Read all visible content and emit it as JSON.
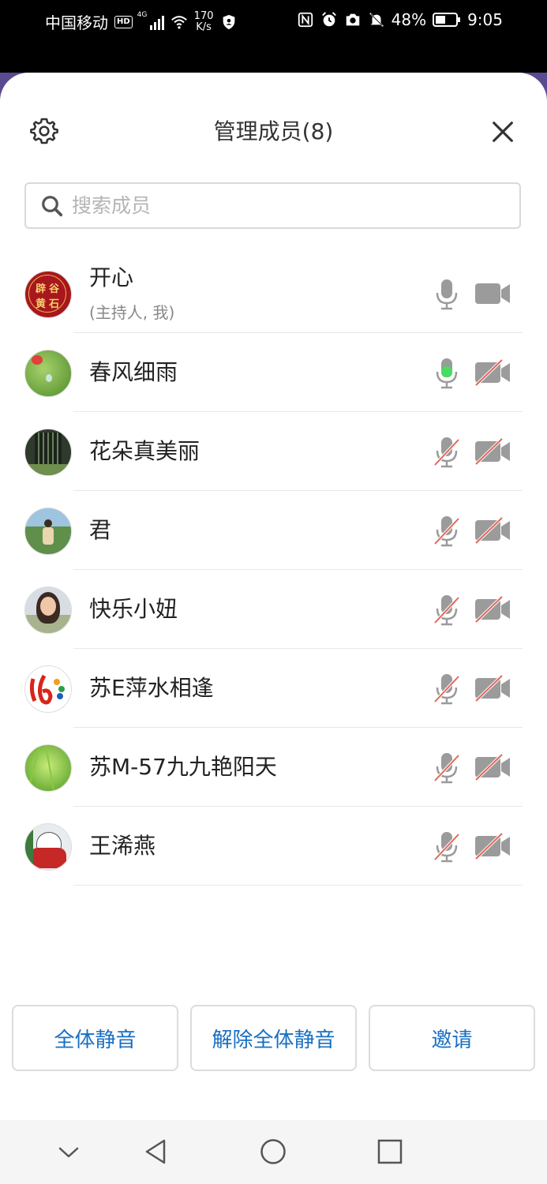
{
  "status_bar": {
    "carrier": "中国移动",
    "hd": "HD",
    "network": "4G",
    "speed_value": "170",
    "speed_unit": "K/s",
    "battery": "48%",
    "time": "9:05"
  },
  "header": {
    "title": "管理成员(8)",
    "settings_icon": "gear-icon",
    "close_icon": "close-icon"
  },
  "search": {
    "placeholder": "搜索成员"
  },
  "members": [
    {
      "name": "开心",
      "sub": "(主持人, 我)",
      "mic": "on",
      "camera": "on"
    },
    {
      "name": "春风细雨",
      "sub": "",
      "mic": "speaking",
      "camera": "off"
    },
    {
      "name": "花朵真美丽",
      "sub": "",
      "mic": "off",
      "camera": "off"
    },
    {
      "name": "君",
      "sub": "",
      "mic": "off",
      "camera": "off"
    },
    {
      "name": "快乐小妞",
      "sub": "",
      "mic": "off",
      "camera": "off"
    },
    {
      "name": "苏E萍水相逢",
      "sub": "",
      "mic": "off",
      "camera": "off"
    },
    {
      "name": "苏M-57九九艳阳天",
      "sub": "",
      "mic": "off",
      "camera": "off"
    },
    {
      "name": "王浠燕",
      "sub": "",
      "mic": "off",
      "camera": "off"
    }
  ],
  "avatar_1_text": [
    "辟",
    "谷",
    "黄",
    "石"
  ],
  "buttons": {
    "mute_all": "全体静音",
    "unmute_all": "解除全体静音",
    "invite": "邀请"
  },
  "colors": {
    "accent": "#1a6fc2",
    "mic_active": "#4cd964",
    "muted_strike": "#e0665a",
    "icon_gray": "#999999"
  }
}
